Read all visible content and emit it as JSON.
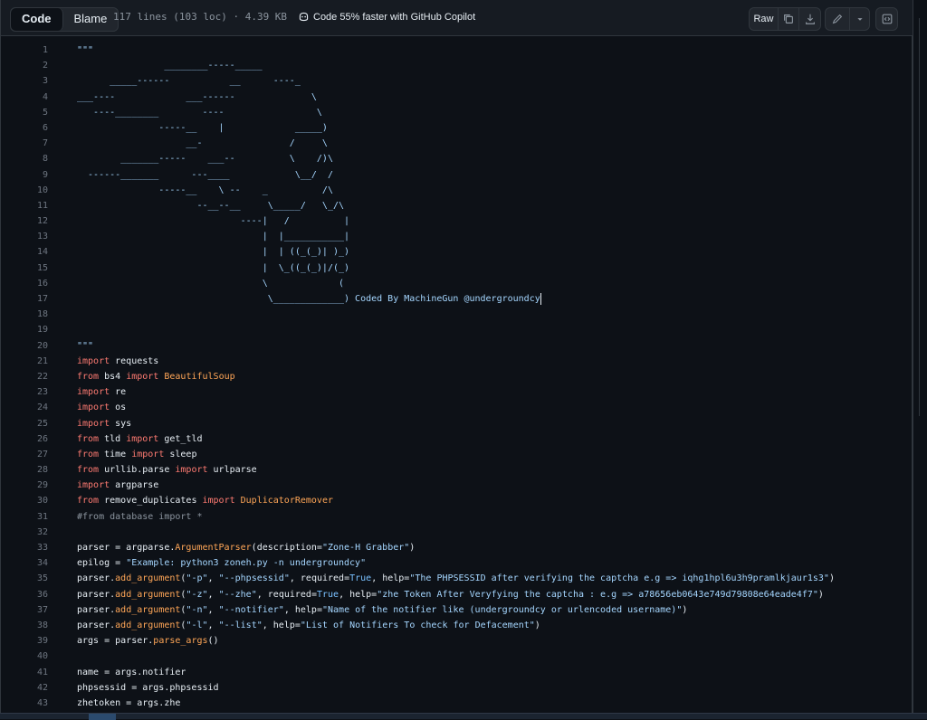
{
  "header": {
    "tabs": [
      {
        "label": "Code",
        "active": true
      },
      {
        "label": "Blame",
        "active": false
      }
    ],
    "file_meta": "117 lines (103 loc) · 4.39 KB",
    "copilot_text": "Code 55% faster with GitHub Copilot",
    "raw_label": "Raw",
    "icons": [
      "copy-icon",
      "download-icon",
      "pencil-icon",
      "chevron-down-icon",
      "symbols-panel-icon",
      "copilot-icon"
    ]
  },
  "colors": {
    "bg": "#0d1117",
    "header": "#161b22",
    "keyword": "#ff7b72",
    "string": "#a5d6ff",
    "class": "#ffa657",
    "comment": "#8b949e",
    "text": "#e6edf3",
    "linenum": "#6e7681"
  },
  "code": {
    "lines": [
      {
        "n": "1",
        "t": [
          [
            "\"\"\"",
            "s"
          ]
        ]
      },
      {
        "n": "2",
        "t": [
          [
            "                ________-----_____",
            "s"
          ]
        ]
      },
      {
        "n": "3",
        "t": [
          [
            "      _____------           __      ----_",
            "s"
          ]
        ]
      },
      {
        "n": "4",
        "t": [
          [
            "___----             ___------              \\",
            "s"
          ]
        ]
      },
      {
        "n": "5",
        "t": [
          [
            "   ----________        ----                 \\",
            "s"
          ]
        ]
      },
      {
        "n": "6",
        "t": [
          [
            "               -----__    |             _____)",
            "s"
          ]
        ]
      },
      {
        "n": "7",
        "t": [
          [
            "                    __-                /     \\",
            "s"
          ]
        ]
      },
      {
        "n": "8",
        "t": [
          [
            "        _______-----    ___--          \\    /)\\",
            "s"
          ]
        ]
      },
      {
        "n": "9",
        "t": [
          [
            "  ------_______      ---____            \\__/  /",
            "s"
          ]
        ]
      },
      {
        "n": "10",
        "t": [
          [
            "               -----__    \\ --    _          /\\",
            "s"
          ]
        ]
      },
      {
        "n": "11",
        "t": [
          [
            "                      --__--__     \\_____/   \\_/\\",
            "s"
          ]
        ]
      },
      {
        "n": "12",
        "t": [
          [
            "                              ----|   /          |",
            "s"
          ]
        ]
      },
      {
        "n": "13",
        "t": [
          [
            "                                  |  |___________|",
            "s"
          ]
        ]
      },
      {
        "n": "14",
        "t": [
          [
            "                                  |  | ((_(_)| )_)",
            "s"
          ]
        ]
      },
      {
        "n": "15",
        "t": [
          [
            "                                  |  \\_((_(_)|/(_)",
            "s"
          ]
        ]
      },
      {
        "n": "16",
        "t": [
          [
            "                                  \\             (",
            "s"
          ]
        ]
      },
      {
        "n": "17",
        "t": [
          [
            "                                   \\_____________) Coded By MachineGun @undergroundcy",
            "s"
          ]
        ],
        "cursor": true
      },
      {
        "n": "18",
        "t": []
      },
      {
        "n": "19",
        "t": []
      },
      {
        "n": "20",
        "t": [
          [
            "\"\"\"",
            "s"
          ]
        ]
      },
      {
        "n": "21",
        "t": [
          [
            "import",
            "k"
          ],
          [
            " requests",
            ""
          ]
        ]
      },
      {
        "n": "22",
        "t": [
          [
            "from",
            "k"
          ],
          [
            " bs4 ",
            ""
          ],
          [
            "import",
            "k"
          ],
          [
            " ",
            ""
          ],
          [
            "BeautifulSoup",
            "o"
          ]
        ]
      },
      {
        "n": "23",
        "t": [
          [
            "import",
            "k"
          ],
          [
            " re",
            ""
          ]
        ]
      },
      {
        "n": "24",
        "t": [
          [
            "import",
            "k"
          ],
          [
            " os",
            ""
          ]
        ]
      },
      {
        "n": "25",
        "t": [
          [
            "import",
            "k"
          ],
          [
            " sys",
            ""
          ]
        ]
      },
      {
        "n": "26",
        "t": [
          [
            "from",
            "k"
          ],
          [
            " tld ",
            ""
          ],
          [
            "import",
            "k"
          ],
          [
            " get_tld",
            ""
          ]
        ]
      },
      {
        "n": "27",
        "t": [
          [
            "from",
            "k"
          ],
          [
            " time ",
            ""
          ],
          [
            "import",
            "k"
          ],
          [
            " sleep",
            ""
          ]
        ]
      },
      {
        "n": "28",
        "t": [
          [
            "from",
            "k"
          ],
          [
            " urllib.parse ",
            ""
          ],
          [
            "import",
            "k"
          ],
          [
            " urlparse",
            ""
          ]
        ]
      },
      {
        "n": "29",
        "t": [
          [
            "import",
            "k"
          ],
          [
            " argparse",
            ""
          ]
        ]
      },
      {
        "n": "30",
        "t": [
          [
            "from",
            "k"
          ],
          [
            " remove_duplicates ",
            ""
          ],
          [
            "import",
            "k"
          ],
          [
            " ",
            ""
          ],
          [
            "DuplicatorRemover",
            "o"
          ]
        ]
      },
      {
        "n": "31",
        "t": [
          [
            "#from database import *",
            "c"
          ]
        ]
      },
      {
        "n": "32",
        "t": []
      },
      {
        "n": "33",
        "t": [
          [
            "parser = argparse.",
            ""
          ],
          [
            "ArgumentParser",
            "o"
          ],
          [
            "(description=",
            ""
          ],
          [
            "\"Zone-H Grabber\"",
            "s"
          ],
          [
            ")",
            ""
          ]
        ]
      },
      {
        "n": "34",
        "t": [
          [
            "epilog = ",
            ""
          ],
          [
            "\"Example: python3 zoneh.py -n undergroundcy\"",
            "s"
          ]
        ]
      },
      {
        "n": "35",
        "t": [
          [
            "parser.",
            ""
          ],
          [
            "add_argument",
            "o"
          ],
          [
            "(",
            ""
          ],
          [
            "\"-p\"",
            "s"
          ],
          [
            ", ",
            ""
          ],
          [
            "\"--phpsessid\"",
            "s"
          ],
          [
            ", required=",
            ""
          ],
          [
            "True",
            "n"
          ],
          [
            ", help=",
            ""
          ],
          [
            "\"The PHPSESSID after verifying the captcha e.g => iqhg1hpl6u3h9pramlkjaur1s3\"",
            "s"
          ],
          [
            ")",
            ""
          ]
        ]
      },
      {
        "n": "36",
        "t": [
          [
            "parser.",
            ""
          ],
          [
            "add_argument",
            "o"
          ],
          [
            "(",
            ""
          ],
          [
            "\"-z\"",
            "s"
          ],
          [
            ", ",
            ""
          ],
          [
            "\"--zhe\"",
            "s"
          ],
          [
            ", required=",
            ""
          ],
          [
            "True",
            "n"
          ],
          [
            ", help=",
            ""
          ],
          [
            "\"zhe Token After Veryfying the captcha : e.g => a78656eb0643e749d79808e64eade4f7\"",
            "s"
          ],
          [
            ")",
            ""
          ]
        ]
      },
      {
        "n": "37",
        "t": [
          [
            "parser.",
            ""
          ],
          [
            "add_argument",
            "o"
          ],
          [
            "(",
            ""
          ],
          [
            "\"-n\"",
            "s"
          ],
          [
            ", ",
            ""
          ],
          [
            "\"--notifier\"",
            "s"
          ],
          [
            ", help=",
            ""
          ],
          [
            "\"Name of the notifier like (undergroundcy or urlencoded username)\"",
            "s"
          ],
          [
            ")",
            ""
          ]
        ]
      },
      {
        "n": "38",
        "t": [
          [
            "parser.",
            ""
          ],
          [
            "add_argument",
            "o"
          ],
          [
            "(",
            ""
          ],
          [
            "\"-l\"",
            "s"
          ],
          [
            ", ",
            ""
          ],
          [
            "\"--list\"",
            "s"
          ],
          [
            ", help=",
            ""
          ],
          [
            "\"List of Notifiers To check for Defacement\"",
            "s"
          ],
          [
            ")",
            ""
          ]
        ]
      },
      {
        "n": "39",
        "t": [
          [
            "args = parser.",
            ""
          ],
          [
            "parse_args",
            "o"
          ],
          [
            "()",
            ""
          ]
        ]
      },
      {
        "n": "40",
        "t": []
      },
      {
        "n": "41",
        "t": [
          [
            "name = args.notifier",
            ""
          ]
        ]
      },
      {
        "n": "42",
        "t": [
          [
            "phpsessid = args.phpsessid",
            ""
          ]
        ]
      },
      {
        "n": "43",
        "t": [
          [
            "zhetoken = args.zhe",
            ""
          ]
        ]
      }
    ]
  }
}
